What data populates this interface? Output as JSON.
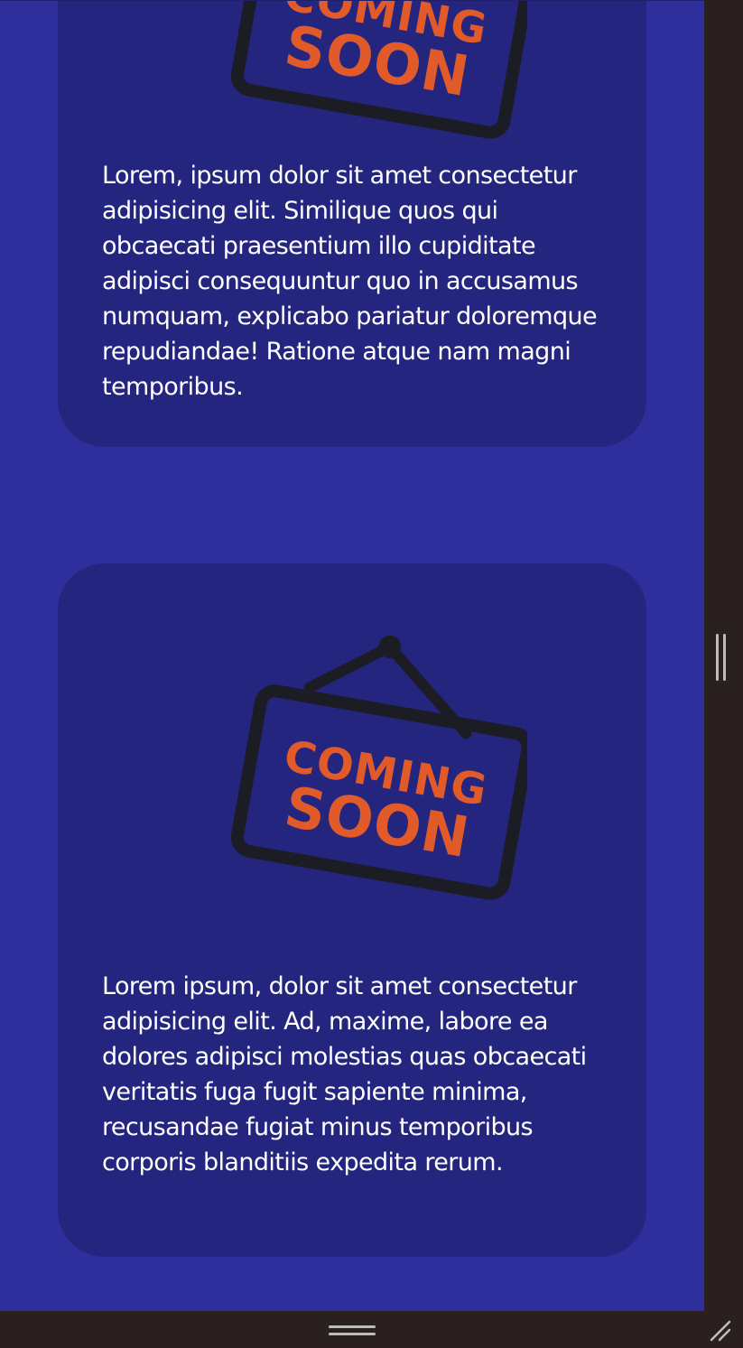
{
  "cards": [
    {
      "sign_line1": "COMING",
      "sign_line2": "SOON",
      "text": "Lorem, ipsum dolor sit amet consectetur adipisicing elit. Similique quos qui obcaecati praesentium illo cupiditate adipisci consequuntur quo in accusamus numquam, explicabo pariatur doloremque repudiandae! Ratione atque nam magni temporibus."
    },
    {
      "sign_line1": "COMING",
      "sign_line2": "SOON",
      "text": "Lorem ipsum, dolor sit amet consectetur adipisicing elit. Ad, maxime, labore ea dolores adipisci molestias quas obcaecati veritatis fuga fugit sapiente minima, recusandae fugiat minus temporibus corporis blanditiis expedita rerum."
    }
  ],
  "colors": {
    "page_background": "#2e2e9c",
    "card_background": "#24257f",
    "sign_text": "#e05a2a",
    "sign_frame": "#1c1c24",
    "body_text": "#ffffff",
    "chrome": "#2a2020"
  },
  "icons": {
    "sign": "coming-soon-sign-icon",
    "vertical_resize": "vertical-split-handle-icon",
    "horizontal_resize": "horizontal-split-handle-icon",
    "corner_resize": "resize-grip-icon"
  }
}
